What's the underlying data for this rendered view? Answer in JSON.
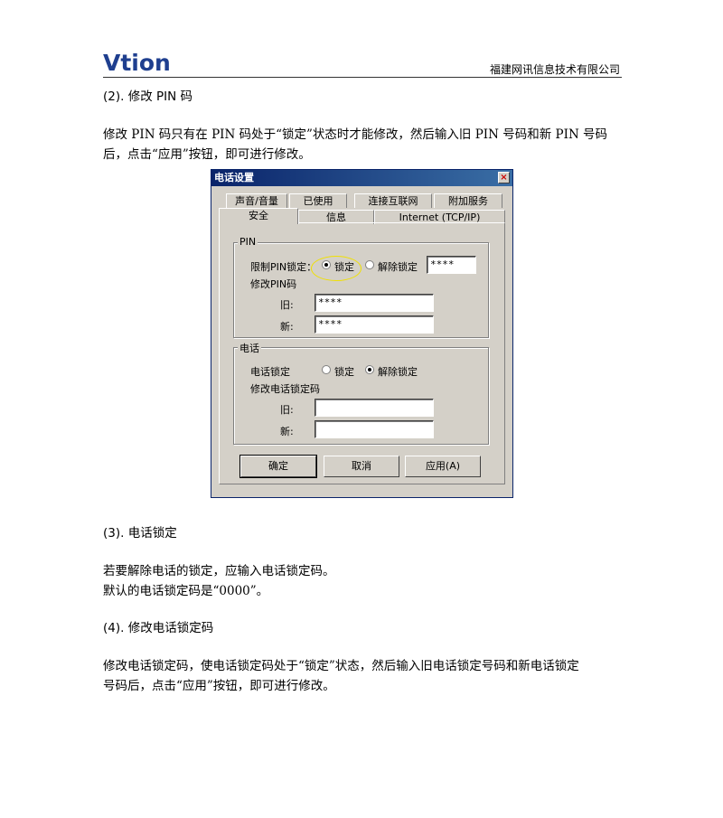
{
  "header": {
    "logo_text": "Vtion",
    "company": "福建网讯信息技术有限公司"
  },
  "section2": {
    "heading": "(2). 修改 PIN 码",
    "para_line1": "修改 PIN 码只有在 PIN 码处于“锁定”状态时才能修改，然后输入旧 PIN 号码和新 PIN 号码",
    "para_line2": "后，点击“应用”按钮，即可进行修改。"
  },
  "dialog": {
    "title": "电话设置",
    "tabs_row1": [
      "声音/音量",
      "已使用",
      "连接互联网",
      "附加服务"
    ],
    "tabs_row2": [
      "安全",
      "信息",
      "Internet (TCP/IP)"
    ],
    "pin_group": {
      "label": "PIN",
      "restrict_label": "限制PIN锁定：",
      "lock_option": "锁定",
      "unlock_option": "解除锁定",
      "current_pin": "****",
      "change_label": "修改PIN码",
      "old_label": "旧:",
      "old_value": "****",
      "new_label": "新:",
      "new_value": "****"
    },
    "phone_group": {
      "label": "电话",
      "lock_label": "电话锁定",
      "lock_option": "锁定",
      "unlock_option": "解除锁定",
      "change_label": "修改电话锁定码",
      "old_label": "旧:",
      "old_value": "",
      "new_label": "新:",
      "new_value": ""
    },
    "buttons": {
      "ok": "确定",
      "cancel": "取消",
      "apply": "应用(A)"
    }
  },
  "section3": {
    "heading": "(3). 电话锁定",
    "line1": "若要解除电话的锁定，应输入电话锁定码。",
    "line2": "默认的电话锁定码是“0000”。"
  },
  "section4": {
    "heading": "(4). 修改电话锁定码",
    "para_line1": "修改电话锁定码，使电话锁定码处于“锁定”状态，然后输入旧电话锁定号码和新电话锁定",
    "para_line2": "号码后，点击“应用”按钮，即可进行修改。"
  },
  "colors": {
    "logo": "#1f3f8f",
    "title_bar": "#0a246a",
    "highlight": "#f0e000"
  }
}
